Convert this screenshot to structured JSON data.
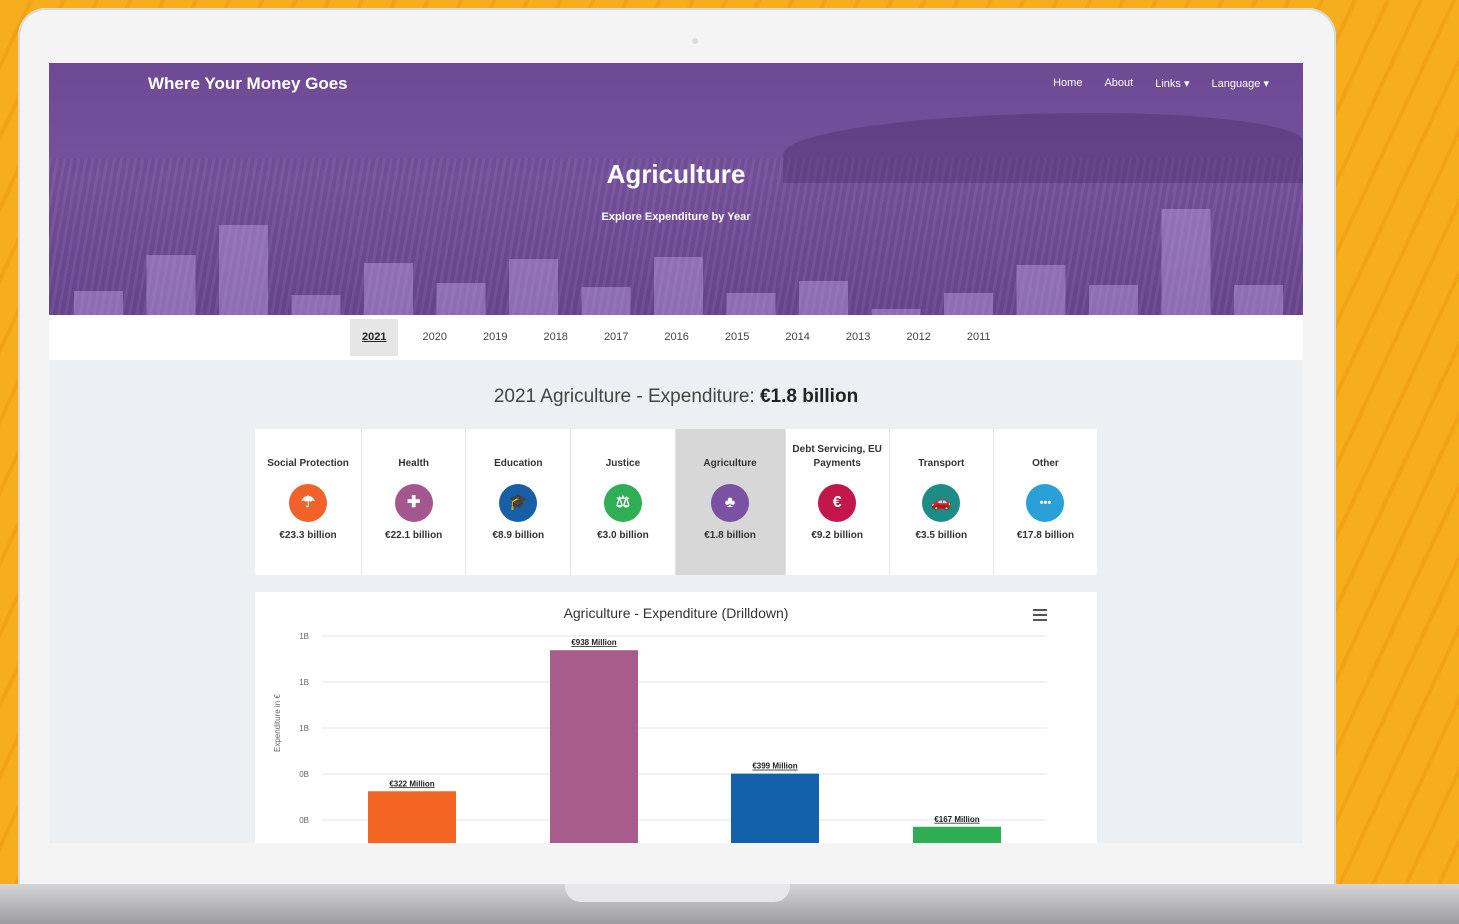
{
  "site": {
    "brand": "Where Your Money Goes",
    "nav": [
      "Home",
      "About",
      "Links ▾",
      "Language ▾"
    ]
  },
  "hero": {
    "title": "Agriculture",
    "subtitle": "Explore Expenditure by Year"
  },
  "years": {
    "items": [
      "2021",
      "2020",
      "2019",
      "2018",
      "2017",
      "2016",
      "2015",
      "2014",
      "2013",
      "2012",
      "2011"
    ],
    "selected": "2021"
  },
  "summary": {
    "prefix": "2021 Agriculture - Expenditure: ",
    "amount": "€1.8 billion"
  },
  "categories": [
    {
      "name": "Social Protection",
      "amount": "€23.3 billion",
      "icon": "umbrella-icon",
      "glyph": "☂",
      "color": "#f0622a",
      "width": 107
    },
    {
      "name": "Health",
      "amount": "€22.1 billion",
      "icon": "health-cross-icon",
      "glyph": "✚",
      "color": "#a4568e",
      "width": 104
    },
    {
      "name": "Education",
      "amount": "€8.9 billion",
      "icon": "graduation-cap-icon",
      "glyph": "🎓",
      "color": "#1760a8",
      "width": 105
    },
    {
      "name": "Justice",
      "amount": "€3.0 billion",
      "icon": "gavel-icon",
      "glyph": "⚖",
      "color": "#2fae55",
      "width": 104
    },
    {
      "name": "Agriculture",
      "amount": "€1.8 billion",
      "icon": "wheat-icon",
      "glyph": "♣",
      "color": "#7a51a3",
      "width": 110,
      "active": true
    },
    {
      "name": "Debt Servicing, EU Payments",
      "amount": "€9.2 billion",
      "icon": "euro-icon",
      "glyph": "€",
      "color": "#c3174b",
      "width": 104
    },
    {
      "name": "Transport",
      "amount": "€3.5 billion",
      "icon": "car-icon",
      "glyph": "🚗",
      "color": "#1e8c86",
      "width": 104
    },
    {
      "name": "Other",
      "amount": "€17.8 billion",
      "icon": "more-dots-icon",
      "glyph": "•••",
      "color": "#2a9fd8",
      "width": 104
    }
  ],
  "chart": {
    "title": "Agriculture - Expenditure (Drilldown)",
    "menu_icon": "hamburger-menu-icon"
  },
  "chart_data": {
    "type": "bar",
    "title": "Agriculture - Expenditure (Drilldown)",
    "ylabel": "Expenditure in €",
    "ytick_labels": [
      "1B",
      "1B",
      "1B",
      "0B",
      "0B"
    ],
    "ylim": [
      0,
      1000
    ],
    "categories": [
      "",
      "",
      "",
      ""
    ],
    "values": [
      322,
      938,
      399,
      167
    ],
    "data_labels": [
      "€322 Million",
      "€938 Million",
      "€399 Million",
      "€167 Million"
    ],
    "colors": [
      "#f26522",
      "#a85c8c",
      "#1361ab",
      "#2ead55"
    ]
  },
  "hero_bars": [
    12,
    30,
    45,
    10,
    26,
    16,
    28,
    14,
    29,
    11,
    17,
    3,
    11,
    25,
    15,
    53,
    15
  ]
}
